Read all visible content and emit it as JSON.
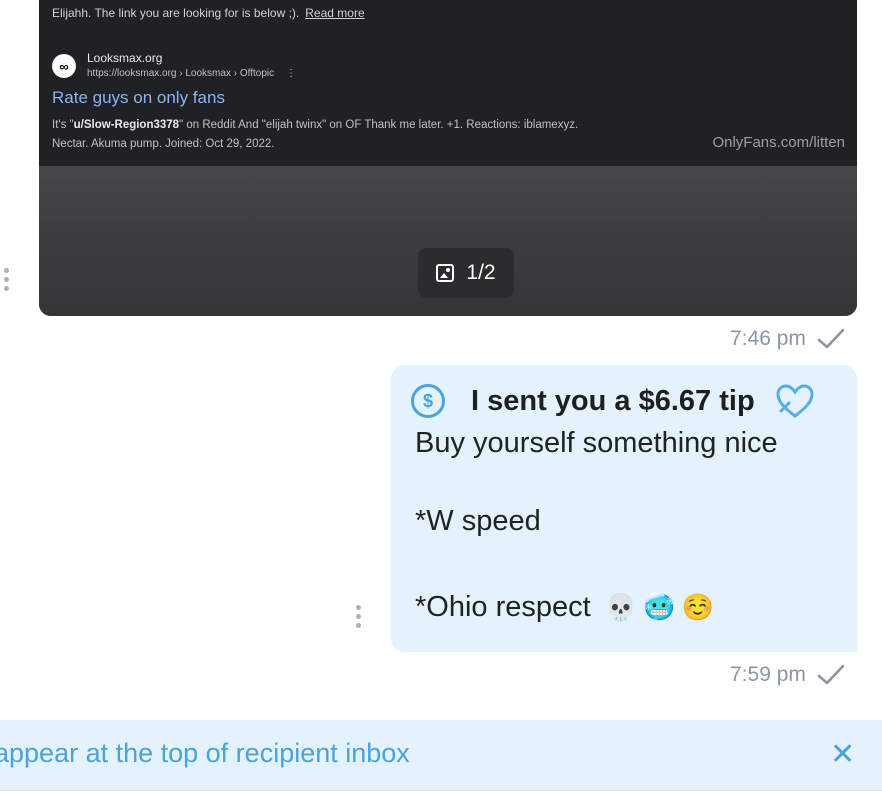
{
  "incoming": {
    "screenshot": {
      "line1_text": "Elijahh. The link you are looking for is below ;).",
      "read_more": "Read more",
      "site_badge": "∞",
      "site_name": "Looksmax.org",
      "site_url": "https://looksmax.org › Looksmax › Offtopic",
      "site_menu": "⋮",
      "result_title": "Rate guys on only fans",
      "snippet_prefix": "It's \"",
      "snippet_bold": "u/Slow-Region3378",
      "snippet_rest": "\" on Reddit And \"elijah twinx\" on OF Thank me later. +1. Reactions: iblamexyz.",
      "snippet_line2": "Nectar. Akuma pump. Joined: Oct 29, 2022.",
      "watermark": "OnlyFans.com/litten"
    },
    "media_counter": "1/2",
    "time": "7:46 pm"
  },
  "outgoing": {
    "tip_text": "I sent you a $6.67 tip",
    "dollar_symbol": "$",
    "line1": "Buy yourself something nice",
    "line2": "*W speed",
    "line3": "*Ohio respect",
    "emojis": [
      "💀",
      "🥶",
      "☺️"
    ],
    "time": "7:59 pm"
  },
  "banner": {
    "text": "appear at the top of recipient inbox",
    "close_symbol": "✕"
  },
  "colors": {
    "accent": "#4aa3db",
    "bubble_bg": "#e3f2fb",
    "meta_gray": "#8a96a3"
  }
}
